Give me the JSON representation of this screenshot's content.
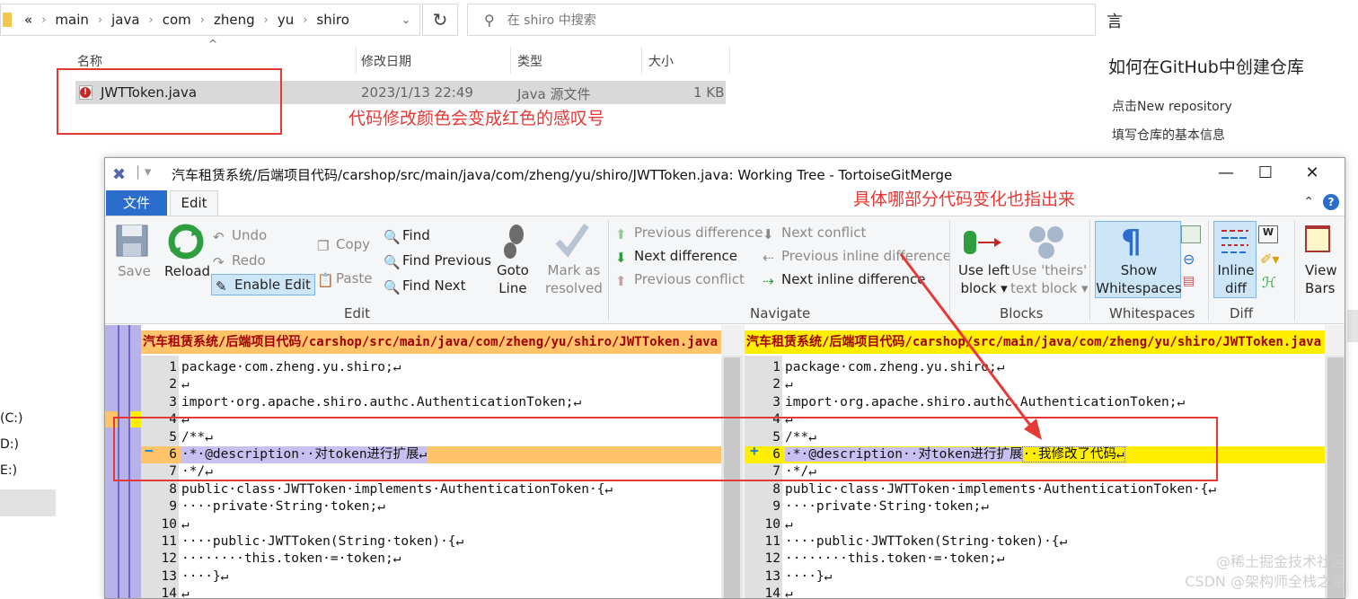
{
  "explorer": {
    "breadcrumb": [
      "«",
      "main",
      "java",
      "com",
      "zheng",
      "yu",
      "shiro"
    ],
    "search_placeholder": "在 shiro 中搜索",
    "columns": {
      "name": "名称",
      "modified": "修改日期",
      "type": "类型",
      "size": "大小"
    },
    "file": {
      "name": "JWTToken.java",
      "modified": "2023/1/13 22:49",
      "type": "Java 源文件",
      "size": "1 KB"
    },
    "drives": [
      "(C:)",
      "D:)",
      "E:)"
    ]
  },
  "annotations": {
    "file_note": "代码修改颜色会变成红色的感叹号",
    "diff_note": "具体哪部分代码变化也指出来"
  },
  "article": {
    "tail_char": "言",
    "heading": "如何在GitHub中创建仓库",
    "items": [
      "点击New repository",
      "填写仓库的基本信息"
    ]
  },
  "merge": {
    "title": "汽车租赁系统/后端项目代码/carshop/src/main/java/com/zheng/yu/shiro/JWTToken.java: Working Tree - TortoiseGitMerge",
    "tabs": {
      "file": "文件",
      "edit": "Edit"
    },
    "ribbon": {
      "save": "Save",
      "reload": "Reload",
      "undo": "Undo",
      "redo": "Redo",
      "enable_edit": "Enable Edit",
      "copy": "Copy",
      "paste": "Paste",
      "find": "Find",
      "find_previous": "Find Previous",
      "find_next": "Find Next",
      "goto_line_1": "Goto",
      "goto_line_2": "Line",
      "mark_resolved_1": "Mark as",
      "mark_resolved_2": "resolved",
      "group_edit": "Edit",
      "prev_diff": "Previous difference",
      "next_diff": "Next difference",
      "prev_conflict": "Previous conflict",
      "next_conflict": "Next conflict",
      "prev_inline": "Previous inline difference",
      "next_inline": "Next inline difference",
      "group_navigate": "Navigate",
      "use_left_1": "Use left",
      "use_left_2": "block",
      "use_theirs_1": "Use 'theirs'",
      "use_theirs_2": "text block",
      "group_blocks": "Blocks",
      "show_ws_1": "Show",
      "show_ws_2": "Whitespaces",
      "group_whitespaces": "Whitespaces",
      "inline_diff_1": "Inline",
      "inline_diff_2": "diff",
      "group_diff": "Diff",
      "view_bars_1": "View",
      "view_bars_2": "Bars"
    },
    "left_header": "汽车租赁系统/后端项目代码/carshop/src/main/java/com/zheng/yu/shiro/JWTToken.java",
    "right_header": "汽车租赁系统/后端项目代码/carshop/src/main/java/com/zheng/yu/shiro/JWTToken.java",
    "left_lines": [
      {
        "n": "1",
        "t": "package·com.zheng.yu.shiro;↵"
      },
      {
        "n": "2",
        "t": "↵"
      },
      {
        "n": "3",
        "t": "import·org.apache.shiro.authc.AuthenticationToken;↵"
      },
      {
        "n": "4",
        "t": "↵"
      },
      {
        "n": "5",
        "t": "/**↵"
      },
      {
        "n": "6",
        "t": "·*·@description··对token进行扩展↵"
      },
      {
        "n": "7",
        "t": "·*/↵"
      },
      {
        "n": "8",
        "t": "public·class·JWTToken·implements·AuthenticationToken·{↵"
      },
      {
        "n": "9",
        "t": "····private·String·token;↵"
      },
      {
        "n": "10",
        "t": "↵"
      },
      {
        "n": "11",
        "t": "····public·JWTToken(String·token)·{↵"
      },
      {
        "n": "12",
        "t": "········this.token·=·token;↵"
      },
      {
        "n": "13",
        "t": "····}↵"
      },
      {
        "n": "14",
        "t": "↵"
      }
    ],
    "right_lines": [
      {
        "n": "1",
        "t": "package·com.zheng.yu.shiro;↵"
      },
      {
        "n": "2",
        "t": "↵"
      },
      {
        "n": "3",
        "t": "import·org.apache.shiro.authc.AuthenticationToken;↵"
      },
      {
        "n": "4",
        "t": "↵"
      },
      {
        "n": "5",
        "t": "/**↵"
      },
      {
        "n": "6",
        "t": "·*·@description··对token进行扩展··我修改了代码↵"
      },
      {
        "n": "7",
        "t": "·*/↵"
      },
      {
        "n": "8",
        "t": "public·class·JWTToken·implements·AuthenticationToken·{↵"
      },
      {
        "n": "9",
        "t": "····private·String·token;↵"
      },
      {
        "n": "10",
        "t": "↵"
      },
      {
        "n": "11",
        "t": "····public·JWTToken(String·token)·{↵"
      },
      {
        "n": "12",
        "t": "········this.token·=·token;↵"
      },
      {
        "n": "13",
        "t": "····}↵"
      },
      {
        "n": "14",
        "t": "↵"
      }
    ],
    "left_marker": "−",
    "right_marker": "+",
    "changed_line_index": 5
  },
  "watermark": {
    "line1": "@稀土掘金技术社区",
    "line2": "CSDN @架构师全栈之路"
  },
  "colors": {
    "annotation": "#e53935",
    "left_change": "#ffc46a",
    "right_change": "#ffee00",
    "accent": "#2a6dcd"
  }
}
